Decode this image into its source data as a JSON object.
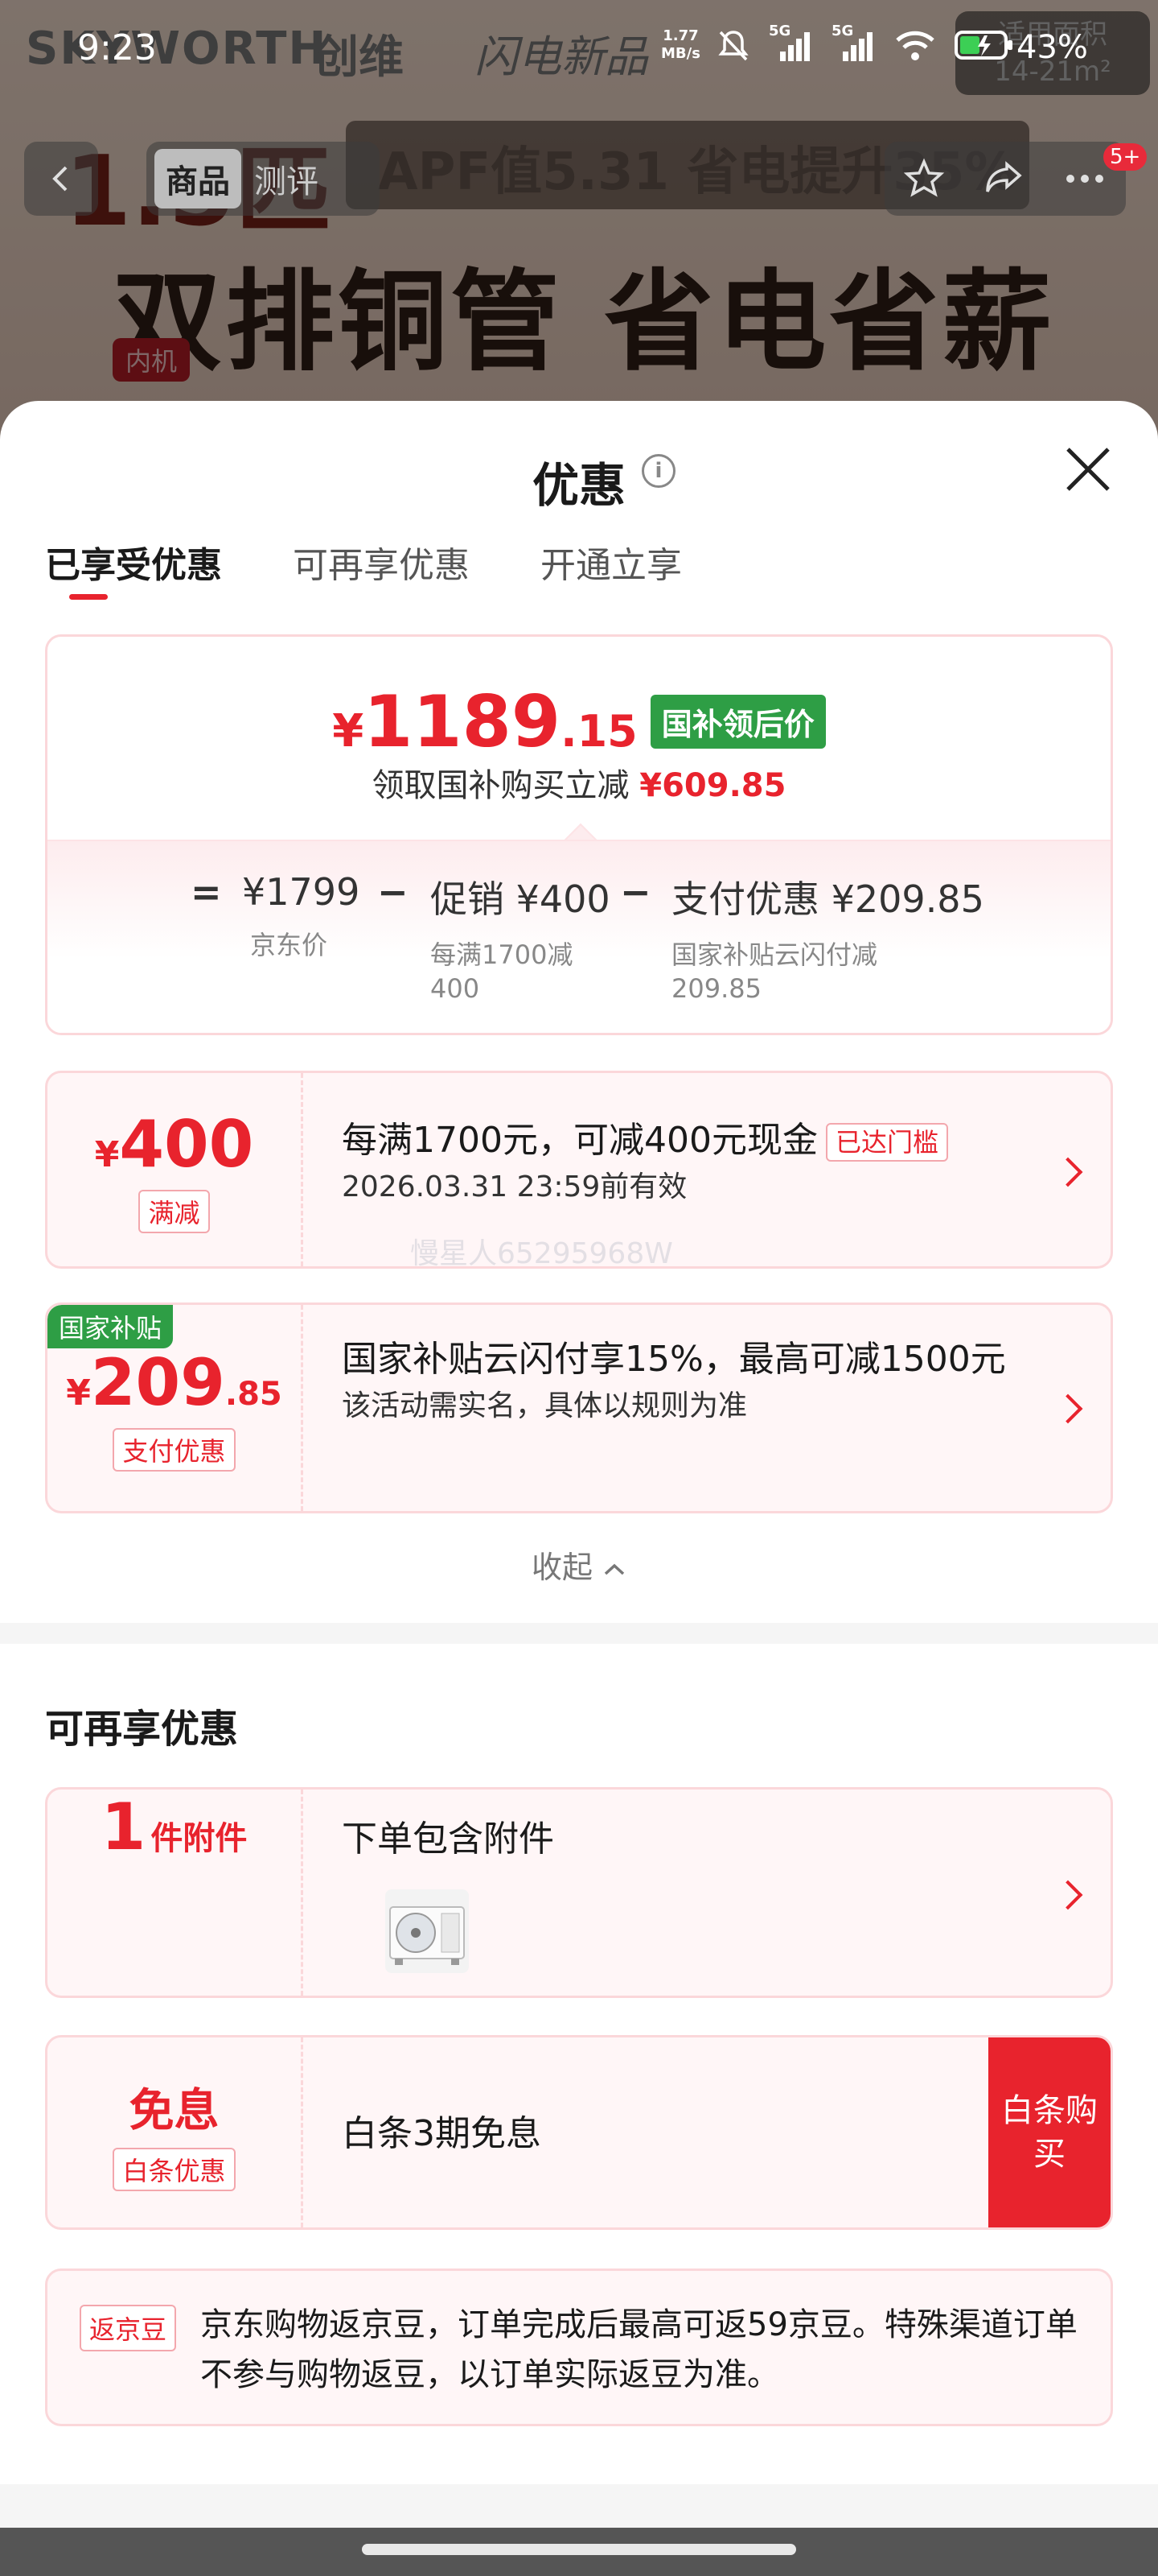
{
  "status_bar": {
    "time": "9:23",
    "net_speed": "1.77",
    "net_unit": "MB/s",
    "sim1": "5G",
    "sim2": "5G",
    "battery": "43%"
  },
  "background": {
    "brand": "SKYWORTH",
    "brand_cn": "创维",
    "slogan": "闪电新品",
    "banner": "APF值5.31 省电提升35%",
    "headline": "双排铜管 省电省薪",
    "big_number": "1.5匹",
    "unit_tag": "内机",
    "area_label": "适用面积",
    "area_value": "14-21m²"
  },
  "product_nav": {
    "tabs": [
      "商品",
      "测评"
    ],
    "active_tab": "商品",
    "badge": "5+"
  },
  "sheet": {
    "title": "优惠",
    "tabs": [
      "已享受优惠",
      "可再享优惠",
      "开通立享"
    ],
    "active_tab": 0
  },
  "price_summary": {
    "currency": "¥",
    "price_int": "1189",
    "price_dec": ".15",
    "price_tag": "国补领后价",
    "subline_prefix": "领取国补购买立减",
    "subline_amount": "¥609.85",
    "breakdown": {
      "eq": "=",
      "minus": "−",
      "jd_price": "¥1799",
      "jd_price_note": "京东价",
      "promo": "促销 ¥400",
      "promo_note_1": "每满1700减",
      "promo_note_2": "400",
      "pay": "支付优惠 ¥209.85",
      "pay_note_1": "国家补贴云闪付减",
      "pay_note_2": "209.85"
    }
  },
  "coupons": {
    "manjian": {
      "currency": "¥",
      "amount": "400",
      "chip": "满减",
      "title": "每满1700元，可减400元现金",
      "status": "已达门槛",
      "validity": "2026.03.31 23:59前有效"
    },
    "subsidy": {
      "flag": "国家补贴",
      "currency": "¥",
      "amount": "209",
      "amount_dec": ".85",
      "chip": "支付优惠",
      "title": "国家补贴云闪付享15%，最高可减1500元",
      "note": "该活动需实名，具体以规则为准"
    }
  },
  "watermark": "慢星人65295968W",
  "collapse_label": "收起",
  "more_section": {
    "title": "可再享优惠",
    "accessory": {
      "count": "1",
      "unit": "件附件",
      "title": "下单包含附件"
    },
    "interest_free": {
      "title_left": "免息",
      "chip": "白条优惠",
      "title": "白条3期免息",
      "buy_button": "白条购买"
    },
    "jd_bean": {
      "chip": "返京豆",
      "text": "京东购物返京豆，订单完成后最高可返59京豆。特殊渠道订单不参与购物返豆，以订单实际返豆为准。"
    }
  },
  "colors": {
    "accent_red": "#e8232d",
    "subsidy_green": "#2e9e45",
    "card_border": "#fbd7da"
  }
}
